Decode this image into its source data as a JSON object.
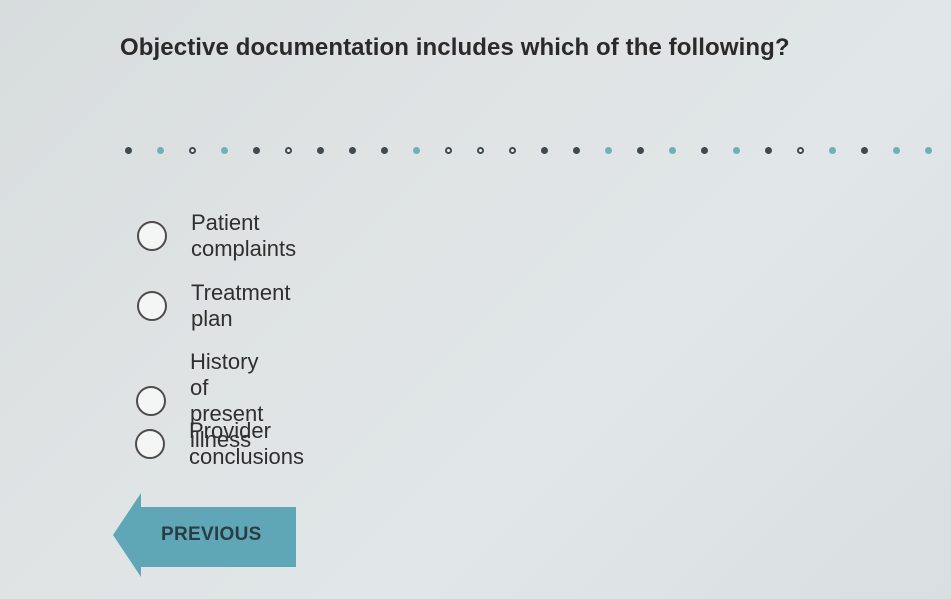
{
  "question": "Objective documentation includes which of the following?",
  "progress": {
    "dots": [
      {
        "state": "filled-dark"
      },
      {
        "state": "filled-teal"
      },
      {
        "state": "open"
      },
      {
        "state": "filled-teal"
      },
      {
        "state": "filled-dark"
      },
      {
        "state": "open"
      },
      {
        "state": "filled-dark"
      },
      {
        "state": "filled-dark"
      },
      {
        "state": "filled-dark"
      },
      {
        "state": "filled-teal"
      },
      {
        "state": "open"
      },
      {
        "state": "open"
      },
      {
        "state": "open"
      },
      {
        "state": "filled-dark"
      },
      {
        "state": "filled-dark"
      },
      {
        "state": "filled-teal"
      },
      {
        "state": "filled-dark"
      },
      {
        "state": "filled-teal"
      },
      {
        "state": "filled-dark"
      },
      {
        "state": "filled-teal"
      },
      {
        "state": "filled-dark"
      },
      {
        "state": "open"
      },
      {
        "state": "filled-teal"
      },
      {
        "state": "filled-dark"
      },
      {
        "state": "filled-teal"
      },
      {
        "state": "filled-teal"
      }
    ]
  },
  "options": [
    {
      "label": "Patient complaints",
      "selected": false
    },
    {
      "label": "Treatment plan",
      "selected": false
    },
    {
      "label": "History of present illness",
      "selected": false
    },
    {
      "label": "Provider conclusions",
      "selected": false
    }
  ],
  "navigation": {
    "previous_label": "PREVIOUS"
  },
  "colors": {
    "button_fill": "#5fa7b6",
    "dot_dark": "#3e4a4f",
    "dot_teal": "#6fb0ba",
    "dot_open_border": "#3e4a4f"
  },
  "icons": {
    "previous_shape": "left-arrow-shape",
    "option_control": "radio-circle"
  }
}
